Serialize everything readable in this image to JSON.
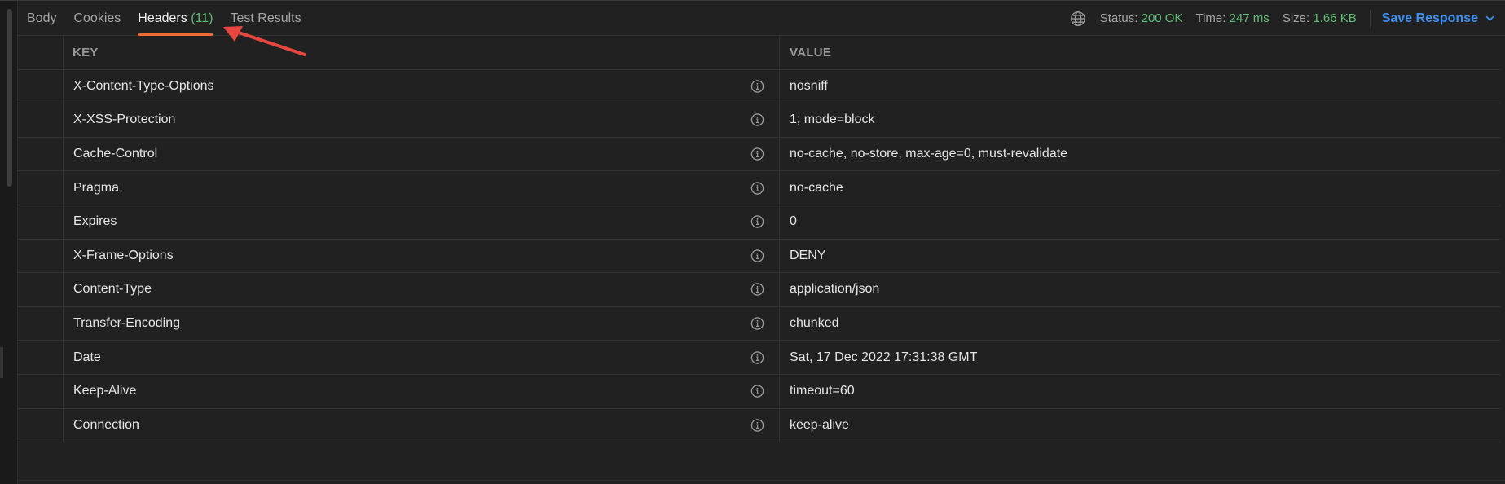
{
  "tabs": [
    {
      "label": "Body",
      "count": ""
    },
    {
      "label": "Cookies",
      "count": ""
    },
    {
      "label": "Headers",
      "count": "(11)"
    },
    {
      "label": "Test Results",
      "count": ""
    }
  ],
  "active_tab": "Headers",
  "status_bar": {
    "status_label": "Status:",
    "status_value": "200 OK",
    "time_label": "Time:",
    "time_value": "247 ms",
    "size_label": "Size:",
    "size_value": "1.66 KB",
    "save_label": "Save Response"
  },
  "table": {
    "columns": {
      "key": "KEY",
      "value": "VALUE"
    },
    "rows": [
      {
        "key": "X-Content-Type-Options",
        "value": "nosniff"
      },
      {
        "key": "X-XSS-Protection",
        "value": "1; mode=block"
      },
      {
        "key": "Cache-Control",
        "value": "no-cache, no-store, max-age=0, must-revalidate"
      },
      {
        "key": "Pragma",
        "value": "no-cache"
      },
      {
        "key": "Expires",
        "value": "0"
      },
      {
        "key": "X-Frame-Options",
        "value": "DENY"
      },
      {
        "key": "Content-Type",
        "value": "application/json"
      },
      {
        "key": "Transfer-Encoding",
        "value": "chunked"
      },
      {
        "key": "Date",
        "value": "Sat, 17 Dec 2022 17:31:38 GMT"
      },
      {
        "key": "Keep-Alive",
        "value": "timeout=60"
      },
      {
        "key": "Connection",
        "value": "keep-alive"
      }
    ]
  },
  "colors": {
    "accent_tab_underline": "#ef6c35",
    "status_green": "#5fbf74",
    "save_blue": "#3d8ff0",
    "annotation_red": "#e8473f"
  },
  "icons": [
    "globe-icon",
    "chevron-down-icon",
    "info-icon",
    "annotation-arrow"
  ]
}
